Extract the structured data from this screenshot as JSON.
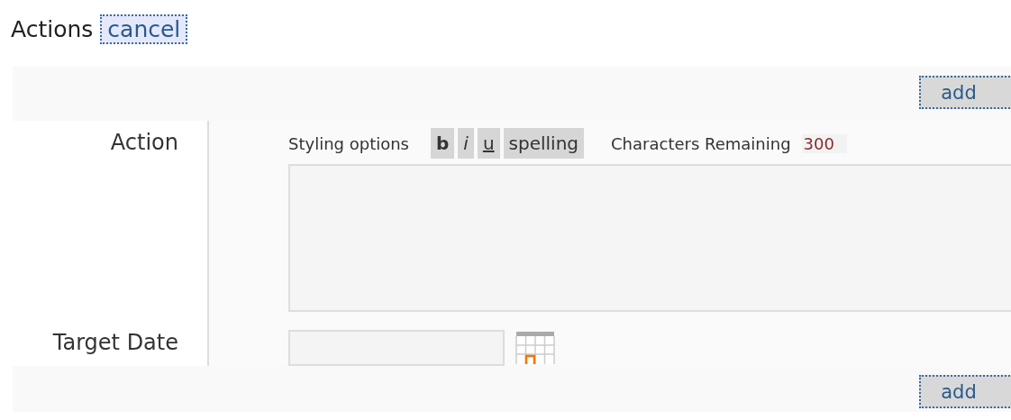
{
  "heading": {
    "title": "Actions",
    "cancel": "cancel"
  },
  "top_bar": {
    "button": "add"
  },
  "fields": [
    {
      "kind": "textarea",
      "label": "Action",
      "styling_label": "Styling options",
      "tools": [
        {
          "kind": "bold",
          "label": "b"
        },
        {
          "kind": "italic",
          "label": "i"
        },
        {
          "kind": "underline",
          "label": "u"
        },
        {
          "kind": "plain",
          "label": "spelling"
        }
      ],
      "counter_label": "Characters Remaining",
      "counter": "300"
    },
    {
      "kind": "date",
      "label": "Target Date"
    }
  ],
  "bottom_bar": {
    "button": "add"
  }
}
